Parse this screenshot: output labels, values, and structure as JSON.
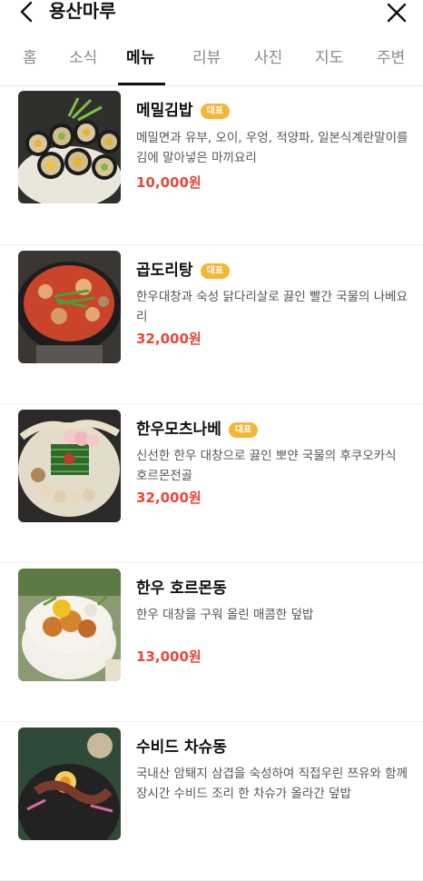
{
  "header": {
    "title": "용산마루",
    "back_icon": "chevron-left-icon",
    "close_icon": "close-icon"
  },
  "tabs": [
    {
      "label": "홈",
      "active": false
    },
    {
      "label": "소식",
      "active": false
    },
    {
      "label": "메뉴",
      "active": true
    },
    {
      "label": "리뷰",
      "active": false
    },
    {
      "label": "사진",
      "active": false
    },
    {
      "label": "지도",
      "active": false
    },
    {
      "label": "주변",
      "active": false
    }
  ],
  "menu": [
    {
      "name": "메밀김밥",
      "badge": "대표",
      "description": "메밀면과 유부, 오이, 우엉, 적양파, 일본식계란말이를 김에 말아넣은 마끼요리",
      "price": "10,000원"
    },
    {
      "name": "곱도리탕",
      "badge": "대표",
      "description": "한우대창과 숙성 닭다리살로 끓인 빨간 국물의 나베요리",
      "price": "32,000원"
    },
    {
      "name": "한우모츠나베",
      "badge": "대표",
      "description": "신선한 한우 대창으로 끓인 뽀얀 국물의 후쿠오카식 호르몬전골",
      "price": "32,000원"
    },
    {
      "name": "한우 호르몬동",
      "badge": "",
      "description": "한우 대창을 구워 올린 매콤한 덮밥",
      "price": "13,000원"
    },
    {
      "name": "수비드 차슈동",
      "badge": "",
      "description": "국내산 암퇘지 삼겹을 숙성하여 직접우린 쯔유와 함께 장시간 수비드 조리 한 차슈가 올라간 덮밥",
      "price": ""
    }
  ],
  "colors": {
    "accent_price": "#e8473a",
    "badge_bg": "#f5b536",
    "active_tab": "#111111",
    "inactive_tab": "#8a8a8a"
  }
}
